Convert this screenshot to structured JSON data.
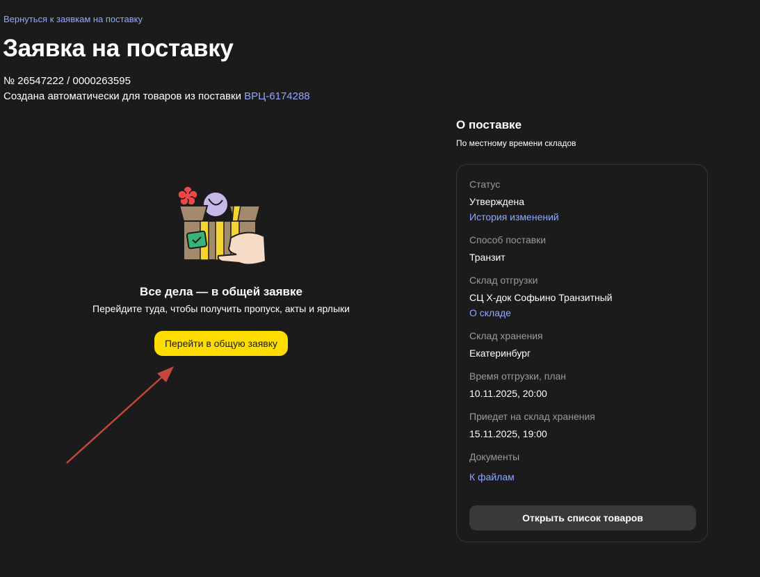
{
  "header": {
    "back_link": "Вернуться к заявкам на поставку",
    "title": "Заявка на поставку",
    "request_number": "№ 26547222 / 0000263595",
    "created_text": "Создана автоматически для товаров из поставки",
    "supply_link": "ВРЦ-6174288"
  },
  "promo": {
    "title": "Все дела — в общей заявке",
    "subtitle": "Перейдите туда, чтобы получить пропуск, акты и ярлыки",
    "button_label": "Перейти в общую заявку"
  },
  "about": {
    "title": "О поставке",
    "subtitle": "По местному времени складов",
    "fields": [
      {
        "label": "Статус",
        "value": "Утверждена",
        "link": "История изменений"
      },
      {
        "label": "Способ поставки",
        "value": "Транзит"
      },
      {
        "label": "Склад отгрузки",
        "value": "СЦ Х-док Софьино Транзитный",
        "link": "О складе"
      },
      {
        "label": "Склад хранения",
        "value": "Екатеринбург"
      },
      {
        "label": "Время отгрузки, план",
        "value": "10.11.2025, 20:00"
      },
      {
        "label": "Приедет на склад хранения",
        "value": "15.11.2025, 19:00"
      },
      {
        "label": "Документы",
        "link": "К файлам"
      }
    ],
    "products_button": "Открыть список товаров"
  },
  "colors": {
    "background": "#1c1b1b",
    "accent_yellow": "#ffdd00",
    "link_blue": "#8fa8ff",
    "annotation_arrow": "#c2473d"
  },
  "icons": {
    "illustration": "box-delivery-illustration",
    "annotation": "red-arrow-annotation"
  }
}
